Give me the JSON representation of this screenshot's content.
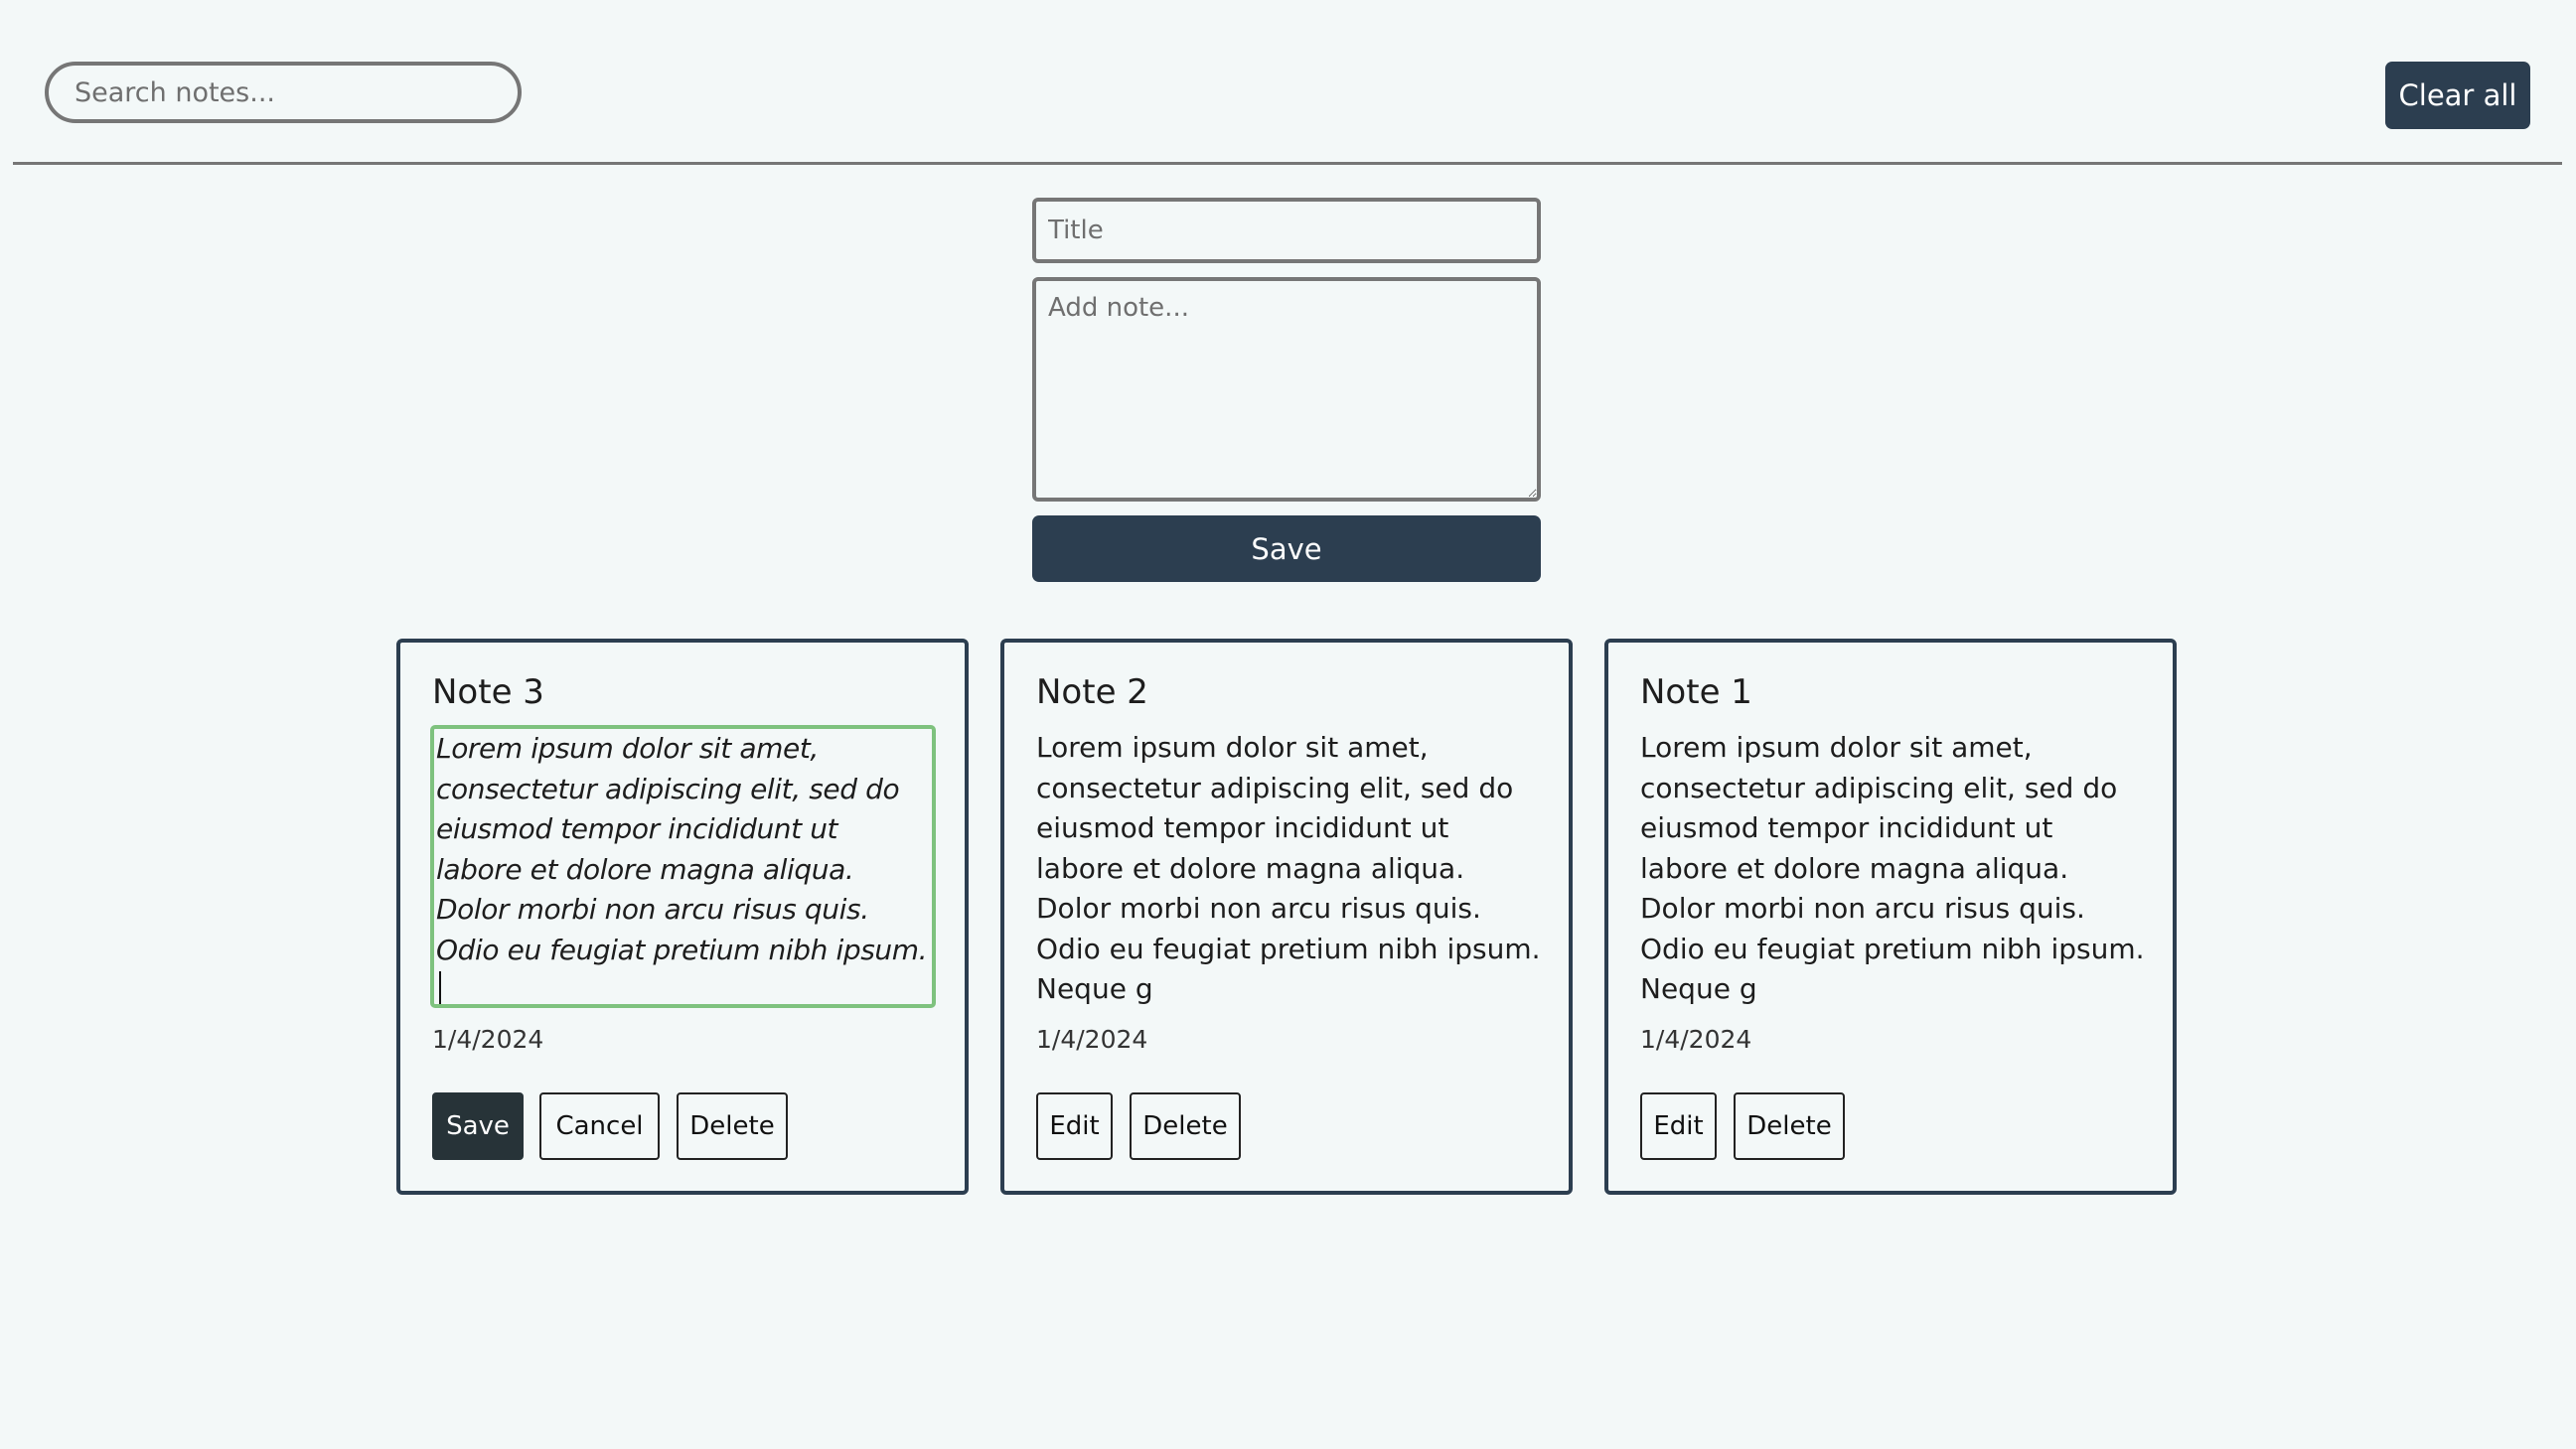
{
  "header": {
    "search_placeholder": "Search notes...",
    "clear_label": "Clear all"
  },
  "composer": {
    "title_placeholder": "Title",
    "note_placeholder": "Add note...",
    "save_label": "Save"
  },
  "notes": [
    {
      "title": "Note 3",
      "body": "Lorem ipsum dolor sit amet, consectetur adipiscing elit, sed do eiusmod tempor incididunt ut labore et dolore magna aliqua. Dolor morbi non arcu risus quis. Odio eu feugiat pretium nibh ipsum.",
      "date": "1/4/2024",
      "editing": true,
      "buttons": [
        "Save",
        "Cancel",
        "Delete"
      ]
    },
    {
      "title": "Note 2",
      "body": "Lorem ipsum dolor sit amet, consectetur adipiscing elit, sed do eiusmod tempor incididunt ut labore et dolore magna aliqua. Dolor morbi non arcu risus quis. Odio eu feugiat pretium nibh ipsum. Neque g",
      "date": "1/4/2024",
      "editing": false,
      "buttons": [
        "Edit",
        "Delete"
      ]
    },
    {
      "title": "Note 1",
      "body": "Lorem ipsum dolor sit amet, consectetur adipiscing elit, sed do eiusmod tempor incididunt ut labore et dolore magna aliqua. Dolor morbi non arcu risus quis. Odio eu feugiat pretium nibh ipsum. Neque g",
      "date": "1/4/2024",
      "editing": false,
      "buttons": [
        "Edit",
        "Delete"
      ]
    }
  ],
  "colors": {
    "background": "#f3f8f8",
    "primary": "#2c3e50",
    "edit_border": "#7ec27e",
    "input_border": "#767676"
  }
}
